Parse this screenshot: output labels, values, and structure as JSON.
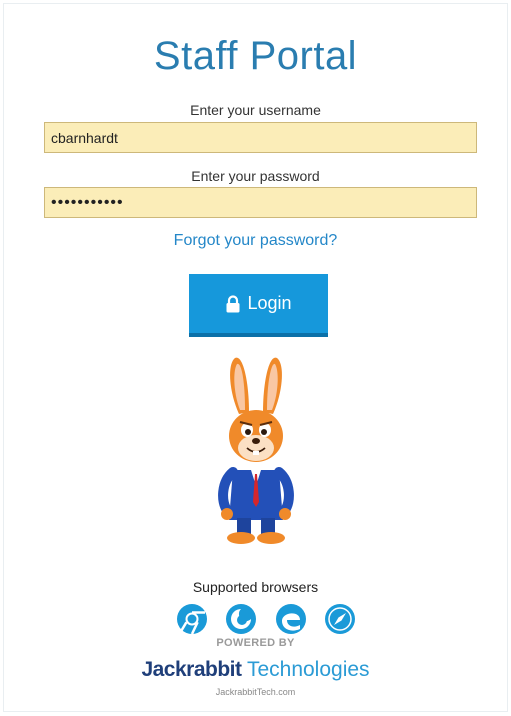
{
  "page": {
    "title": "Staff Portal"
  },
  "login_form": {
    "username_label": "Enter your username",
    "username_value": "cbarnhardt",
    "password_label": "Enter your password",
    "password_value": "•••••••••••",
    "forgot_password_link": "Forgot your password?",
    "login_button_label": "Login",
    "login_button_icon": "lock-icon"
  },
  "mascot": {
    "icon": "jackrabbit-mascot"
  },
  "footer": {
    "supported_browsers_label": "Supported browsers",
    "browsers": [
      {
        "icon": "chrome-icon"
      },
      {
        "icon": "firefox-icon"
      },
      {
        "icon": "edge-icon"
      },
      {
        "icon": "safari-icon"
      }
    ],
    "powered_by": "POWERED BY",
    "brand_bold": "Jackrabbit",
    "brand_light": " Technologies",
    "brand_url": "JackrabbitTech.com"
  },
  "colors": {
    "title": "#2a7db0",
    "link": "#2487c8",
    "button": "#1698db",
    "field_bg": "#fbedb8",
    "brand_dark": "#1f3f7a",
    "brand_light": "#2b9bd5"
  }
}
